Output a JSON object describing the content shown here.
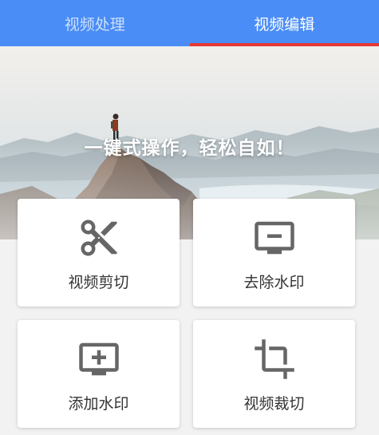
{
  "tabs": [
    {
      "label": "视频处理",
      "active": false
    },
    {
      "label": "视频编辑",
      "active": true
    }
  ],
  "banner": {
    "slogan": "一键式操作，轻松自如！"
  },
  "actions": [
    {
      "label": "视频剪切",
      "icon": "scissors-icon"
    },
    {
      "label": "去除水印",
      "icon": "monitor-minus-icon"
    },
    {
      "label": "添加水印",
      "icon": "monitor-plus-icon"
    },
    {
      "label": "视频裁切",
      "icon": "crop-icon"
    }
  ],
  "colors": {
    "header": "#4a8df6",
    "indicator": "#e53935",
    "icon": "#666666"
  }
}
